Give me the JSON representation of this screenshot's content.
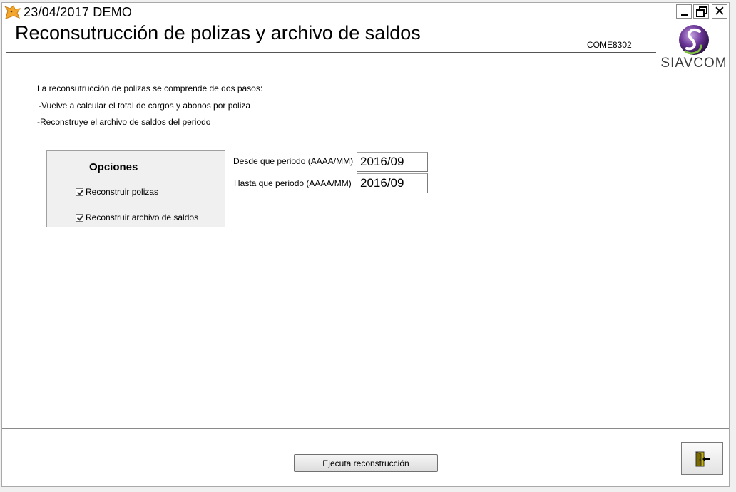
{
  "titlebar": {
    "title": "23/04/2017  DEMO",
    "app_icon": "fox-app-icon",
    "minimize_icon": "minimize-icon",
    "maximize_icon": "restore-icon",
    "close_icon": "close-icon",
    "close_glyph": "✕"
  },
  "header": {
    "title": "Reconsutrucción de polizas y archivo de saldos",
    "screen_code": "COME8302",
    "logo_text": "SIAVCOM"
  },
  "intro": {
    "line1": "La reconsutrucción de polizas se comprende de dos pasos:",
    "line2": "-Vuelve a calcular el total de cargos y abonos por poliza",
    "line3": "-Reconstruye el archivo de saldos del periodo"
  },
  "options": {
    "title": "Opciones",
    "items": [
      {
        "label": "Reconstruir polizas",
        "checked": true
      },
      {
        "label": "Reconstruir archivo de saldos",
        "checked": true
      }
    ]
  },
  "period": {
    "from_label": "Desde que periodo (AAAA/MM)",
    "from_value": "2016/09",
    "to_label": "Hasta que periodo (AAAA/MM)",
    "to_value": "2016/09"
  },
  "footer": {
    "execute_label": "Ejecuta reconstrucción",
    "exit_icon": "exit-door-icon"
  },
  "colors": {
    "window_bg": "#ffffff",
    "panel_bg": "#f0f0f0",
    "logo_purple": "#5b2a82",
    "logo_green": "#7fbf3f"
  }
}
